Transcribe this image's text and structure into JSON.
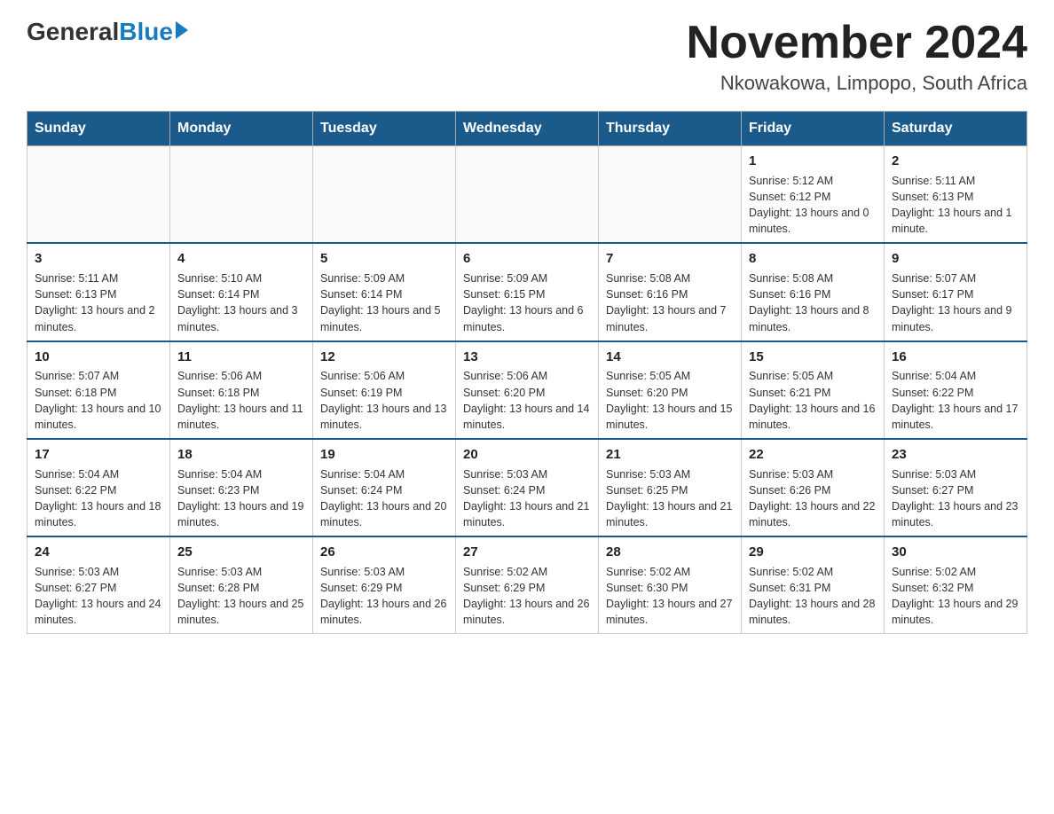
{
  "header": {
    "logo_general": "General",
    "logo_blue": "Blue",
    "month_title": "November 2024",
    "location": "Nkowakowa, Limpopo, South Africa"
  },
  "days_of_week": [
    "Sunday",
    "Monday",
    "Tuesday",
    "Wednesday",
    "Thursday",
    "Friday",
    "Saturday"
  ],
  "weeks": [
    [
      {
        "day": "",
        "info": ""
      },
      {
        "day": "",
        "info": ""
      },
      {
        "day": "",
        "info": ""
      },
      {
        "day": "",
        "info": ""
      },
      {
        "day": "",
        "info": ""
      },
      {
        "day": "1",
        "info": "Sunrise: 5:12 AM\nSunset: 6:12 PM\nDaylight: 13 hours and 0 minutes."
      },
      {
        "day": "2",
        "info": "Sunrise: 5:11 AM\nSunset: 6:13 PM\nDaylight: 13 hours and 1 minute."
      }
    ],
    [
      {
        "day": "3",
        "info": "Sunrise: 5:11 AM\nSunset: 6:13 PM\nDaylight: 13 hours and 2 minutes."
      },
      {
        "day": "4",
        "info": "Sunrise: 5:10 AM\nSunset: 6:14 PM\nDaylight: 13 hours and 3 minutes."
      },
      {
        "day": "5",
        "info": "Sunrise: 5:09 AM\nSunset: 6:14 PM\nDaylight: 13 hours and 5 minutes."
      },
      {
        "day": "6",
        "info": "Sunrise: 5:09 AM\nSunset: 6:15 PM\nDaylight: 13 hours and 6 minutes."
      },
      {
        "day": "7",
        "info": "Sunrise: 5:08 AM\nSunset: 6:16 PM\nDaylight: 13 hours and 7 minutes."
      },
      {
        "day": "8",
        "info": "Sunrise: 5:08 AM\nSunset: 6:16 PM\nDaylight: 13 hours and 8 minutes."
      },
      {
        "day": "9",
        "info": "Sunrise: 5:07 AM\nSunset: 6:17 PM\nDaylight: 13 hours and 9 minutes."
      }
    ],
    [
      {
        "day": "10",
        "info": "Sunrise: 5:07 AM\nSunset: 6:18 PM\nDaylight: 13 hours and 10 minutes."
      },
      {
        "day": "11",
        "info": "Sunrise: 5:06 AM\nSunset: 6:18 PM\nDaylight: 13 hours and 11 minutes."
      },
      {
        "day": "12",
        "info": "Sunrise: 5:06 AM\nSunset: 6:19 PM\nDaylight: 13 hours and 13 minutes."
      },
      {
        "day": "13",
        "info": "Sunrise: 5:06 AM\nSunset: 6:20 PM\nDaylight: 13 hours and 14 minutes."
      },
      {
        "day": "14",
        "info": "Sunrise: 5:05 AM\nSunset: 6:20 PM\nDaylight: 13 hours and 15 minutes."
      },
      {
        "day": "15",
        "info": "Sunrise: 5:05 AM\nSunset: 6:21 PM\nDaylight: 13 hours and 16 minutes."
      },
      {
        "day": "16",
        "info": "Sunrise: 5:04 AM\nSunset: 6:22 PM\nDaylight: 13 hours and 17 minutes."
      }
    ],
    [
      {
        "day": "17",
        "info": "Sunrise: 5:04 AM\nSunset: 6:22 PM\nDaylight: 13 hours and 18 minutes."
      },
      {
        "day": "18",
        "info": "Sunrise: 5:04 AM\nSunset: 6:23 PM\nDaylight: 13 hours and 19 minutes."
      },
      {
        "day": "19",
        "info": "Sunrise: 5:04 AM\nSunset: 6:24 PM\nDaylight: 13 hours and 20 minutes."
      },
      {
        "day": "20",
        "info": "Sunrise: 5:03 AM\nSunset: 6:24 PM\nDaylight: 13 hours and 21 minutes."
      },
      {
        "day": "21",
        "info": "Sunrise: 5:03 AM\nSunset: 6:25 PM\nDaylight: 13 hours and 21 minutes."
      },
      {
        "day": "22",
        "info": "Sunrise: 5:03 AM\nSunset: 6:26 PM\nDaylight: 13 hours and 22 minutes."
      },
      {
        "day": "23",
        "info": "Sunrise: 5:03 AM\nSunset: 6:27 PM\nDaylight: 13 hours and 23 minutes."
      }
    ],
    [
      {
        "day": "24",
        "info": "Sunrise: 5:03 AM\nSunset: 6:27 PM\nDaylight: 13 hours and 24 minutes."
      },
      {
        "day": "25",
        "info": "Sunrise: 5:03 AM\nSunset: 6:28 PM\nDaylight: 13 hours and 25 minutes."
      },
      {
        "day": "26",
        "info": "Sunrise: 5:03 AM\nSunset: 6:29 PM\nDaylight: 13 hours and 26 minutes."
      },
      {
        "day": "27",
        "info": "Sunrise: 5:02 AM\nSunset: 6:29 PM\nDaylight: 13 hours and 26 minutes."
      },
      {
        "day": "28",
        "info": "Sunrise: 5:02 AM\nSunset: 6:30 PM\nDaylight: 13 hours and 27 minutes."
      },
      {
        "day": "29",
        "info": "Sunrise: 5:02 AM\nSunset: 6:31 PM\nDaylight: 13 hours and 28 minutes."
      },
      {
        "day": "30",
        "info": "Sunrise: 5:02 AM\nSunset: 6:32 PM\nDaylight: 13 hours and 29 minutes."
      }
    ]
  ]
}
